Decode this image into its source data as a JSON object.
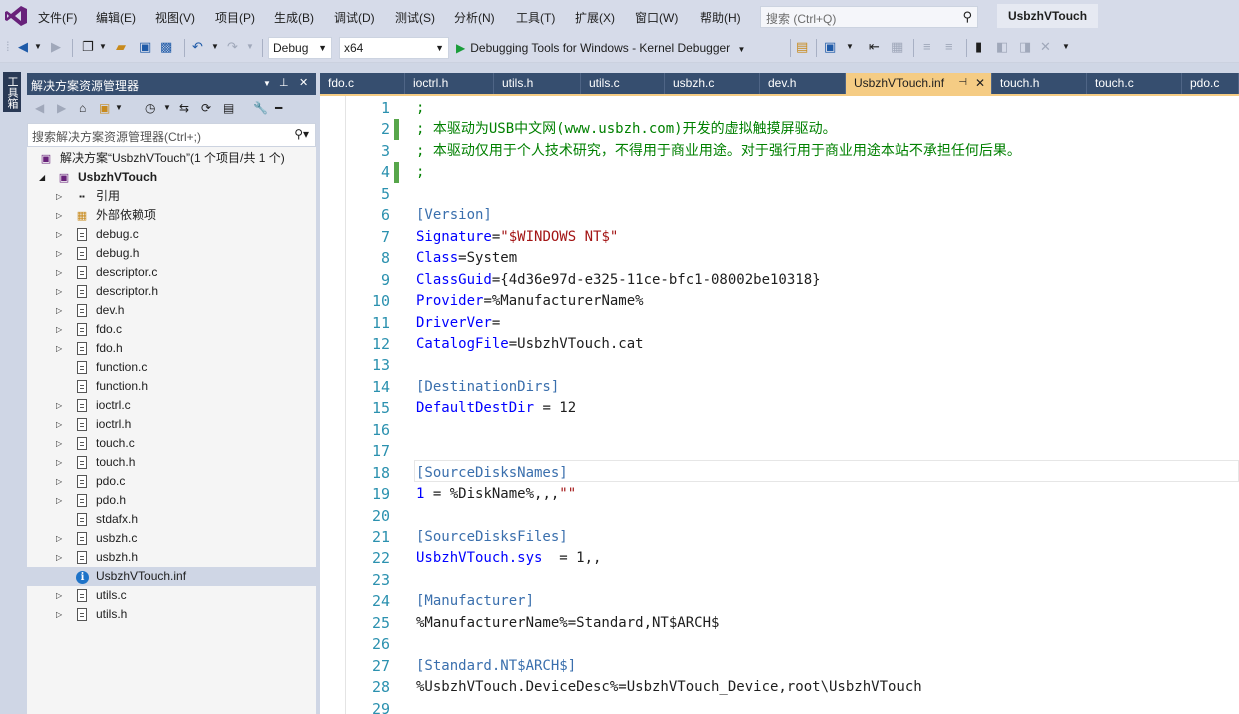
{
  "menubar": {
    "items": [
      "文件(F)",
      "编辑(E)",
      "视图(V)",
      "项目(P)",
      "生成(B)",
      "调试(D)",
      "测试(S)",
      "分析(N)",
      "工具(T)",
      "扩展(X)",
      "窗口(W)",
      "帮助(H)"
    ],
    "search_placeholder": "搜索 (Ctrl+Q)",
    "solution_name": "UsbzhVTouch"
  },
  "toolbar": {
    "config": "Debug",
    "platform": "x64",
    "run_label": "Debugging Tools for Windows - Kernel Debugger"
  },
  "toolbox": {
    "label": "工具箱"
  },
  "solution_explorer": {
    "title": "解决方案资源管理器",
    "search_placeholder": "搜索解决方案资源管理器(Ctrl+;)",
    "solution_label": "解决方案“UsbzhVTouch”(1 个项目/共 1 个)",
    "project_label": "UsbzhVTouch",
    "items": [
      {
        "label": "引用",
        "icon": "references-icon",
        "expandable": true
      },
      {
        "label": "外部依赖项",
        "icon": "external-deps-icon",
        "expandable": true
      },
      {
        "label": "debug.c",
        "icon": "file-icon",
        "expandable": true
      },
      {
        "label": "debug.h",
        "icon": "file-icon",
        "expandable": true
      },
      {
        "label": "descriptor.c",
        "icon": "file-icon",
        "expandable": true
      },
      {
        "label": "descriptor.h",
        "icon": "file-icon",
        "expandable": true
      },
      {
        "label": "dev.h",
        "icon": "file-icon",
        "expandable": true
      },
      {
        "label": "fdo.c",
        "icon": "file-icon",
        "expandable": true
      },
      {
        "label": "fdo.h",
        "icon": "file-icon",
        "expandable": true
      },
      {
        "label": "function.c",
        "icon": "file-icon",
        "expandable": false
      },
      {
        "label": "function.h",
        "icon": "file-icon",
        "expandable": false
      },
      {
        "label": "ioctrl.c",
        "icon": "file-icon",
        "expandable": true
      },
      {
        "label": "ioctrl.h",
        "icon": "file-icon",
        "expandable": true
      },
      {
        "label": "touch.c",
        "icon": "file-icon",
        "expandable": true
      },
      {
        "label": "touch.h",
        "icon": "file-icon",
        "expandable": true
      },
      {
        "label": "pdo.c",
        "icon": "file-icon",
        "expandable": true
      },
      {
        "label": "pdo.h",
        "icon": "file-icon",
        "expandable": true
      },
      {
        "label": "stdafx.h",
        "icon": "file-icon",
        "expandable": false
      },
      {
        "label": "usbzh.c",
        "icon": "file-icon",
        "expandable": true
      },
      {
        "label": "usbzh.h",
        "icon": "file-icon",
        "expandable": true
      },
      {
        "label": "UsbzhVTouch.inf",
        "icon": "info-icon",
        "expandable": false,
        "selected": true
      },
      {
        "label": "utils.c",
        "icon": "file-icon",
        "expandable": true
      },
      {
        "label": "utils.h",
        "icon": "file-icon",
        "expandable": true
      }
    ]
  },
  "tabs": [
    {
      "label": "fdo.c"
    },
    {
      "label": "ioctrl.h"
    },
    {
      "label": "utils.h"
    },
    {
      "label": "utils.c"
    },
    {
      "label": "usbzh.c"
    },
    {
      "label": "dev.h"
    },
    {
      "label": "UsbzhVTouch.inf",
      "active": true
    },
    {
      "label": "touch.h"
    },
    {
      "label": "touch.c"
    },
    {
      "label": "pdo.c"
    }
  ],
  "editor": {
    "lines": [
      {
        "n": "1",
        "changed": false,
        "parts": [
          {
            "t": ";",
            "c": "comment"
          }
        ]
      },
      {
        "n": "2",
        "changed": true,
        "parts": [
          {
            "t": "; 本驱动为USB中文网(www.usbzh.com)开发的虚拟触摸屏驱动。",
            "c": "comment"
          }
        ]
      },
      {
        "n": "3",
        "changed": false,
        "parts": [
          {
            "t": "; 本驱动仅用于个人技术研究，不得用于商业用途。对于强行用于商业用途本站不承担任何后果。",
            "c": "comment"
          }
        ]
      },
      {
        "n": "4",
        "changed": true,
        "parts": [
          {
            "t": ";",
            "c": "comment"
          }
        ]
      },
      {
        "n": "5",
        "changed": false,
        "parts": []
      },
      {
        "n": "6",
        "changed": false,
        "parts": [
          {
            "t": "[Version]",
            "c": "section"
          }
        ]
      },
      {
        "n": "7",
        "changed": false,
        "parts": [
          {
            "t": "Signature",
            "c": "key"
          },
          {
            "t": "=",
            "c": "text"
          },
          {
            "t": "\"$WINDOWS NT$\"",
            "c": "string"
          }
        ]
      },
      {
        "n": "8",
        "changed": false,
        "parts": [
          {
            "t": "Class",
            "c": "key"
          },
          {
            "t": "=System",
            "c": "text"
          }
        ]
      },
      {
        "n": "9",
        "changed": false,
        "parts": [
          {
            "t": "ClassGuid",
            "c": "key"
          },
          {
            "t": "={4d36e97d-e325-11ce-bfc1-08002be10318}",
            "c": "text"
          }
        ]
      },
      {
        "n": "10",
        "changed": false,
        "parts": [
          {
            "t": "Provider",
            "c": "key"
          },
          {
            "t": "=%ManufacturerName%",
            "c": "text"
          }
        ]
      },
      {
        "n": "11",
        "changed": false,
        "parts": [
          {
            "t": "DriverVer",
            "c": "key"
          },
          {
            "t": "=",
            "c": "text"
          }
        ]
      },
      {
        "n": "12",
        "changed": false,
        "parts": [
          {
            "t": "CatalogFile",
            "c": "key"
          },
          {
            "t": "=UsbzhVTouch.cat",
            "c": "text"
          }
        ]
      },
      {
        "n": "13",
        "changed": false,
        "parts": []
      },
      {
        "n": "14",
        "changed": false,
        "parts": [
          {
            "t": "[DestinationDirs]",
            "c": "section"
          }
        ]
      },
      {
        "n": "15",
        "changed": false,
        "parts": [
          {
            "t": "DefaultDestDir",
            "c": "key"
          },
          {
            "t": " = 12",
            "c": "text"
          }
        ]
      },
      {
        "n": "16",
        "changed": false,
        "parts": []
      },
      {
        "n": "17",
        "changed": false,
        "parts": []
      },
      {
        "n": "18",
        "changed": false,
        "parts": [
          {
            "t": "[SourceDisksNames]",
            "c": "section"
          }
        ]
      },
      {
        "n": "19",
        "changed": false,
        "parts": [
          {
            "t": "1",
            "c": "key"
          },
          {
            "t": " = %DiskName%,,,",
            "c": "text"
          },
          {
            "t": "\"\"",
            "c": "string"
          }
        ]
      },
      {
        "n": "20",
        "changed": false,
        "parts": []
      },
      {
        "n": "21",
        "changed": false,
        "parts": [
          {
            "t": "[SourceDisksFiles]",
            "c": "section"
          }
        ]
      },
      {
        "n": "22",
        "changed": false,
        "parts": [
          {
            "t": "UsbzhVTouch.sys",
            "c": "key"
          },
          {
            "t": "  = 1,,",
            "c": "text"
          }
        ]
      },
      {
        "n": "23",
        "changed": false,
        "parts": []
      },
      {
        "n": "24",
        "changed": false,
        "parts": [
          {
            "t": "[Manufacturer]",
            "c": "section"
          }
        ]
      },
      {
        "n": "25",
        "changed": false,
        "parts": [
          {
            "t": "%ManufacturerName%=Standard,NT$ARCH$",
            "c": "text"
          }
        ]
      },
      {
        "n": "26",
        "changed": false,
        "parts": []
      },
      {
        "n": "27",
        "changed": false,
        "parts": [
          {
            "t": "[Standard.NT$ARCH$]",
            "c": "section"
          }
        ]
      },
      {
        "n": "28",
        "changed": false,
        "parts": [
          {
            "t": "%UsbzhVTouch.DeviceDesc%=UsbzhVTouch_Device,root\\UsbzhVTouch",
            "c": "text"
          }
        ]
      },
      {
        "n": "29",
        "changed": false,
        "parts": []
      }
    ]
  }
}
